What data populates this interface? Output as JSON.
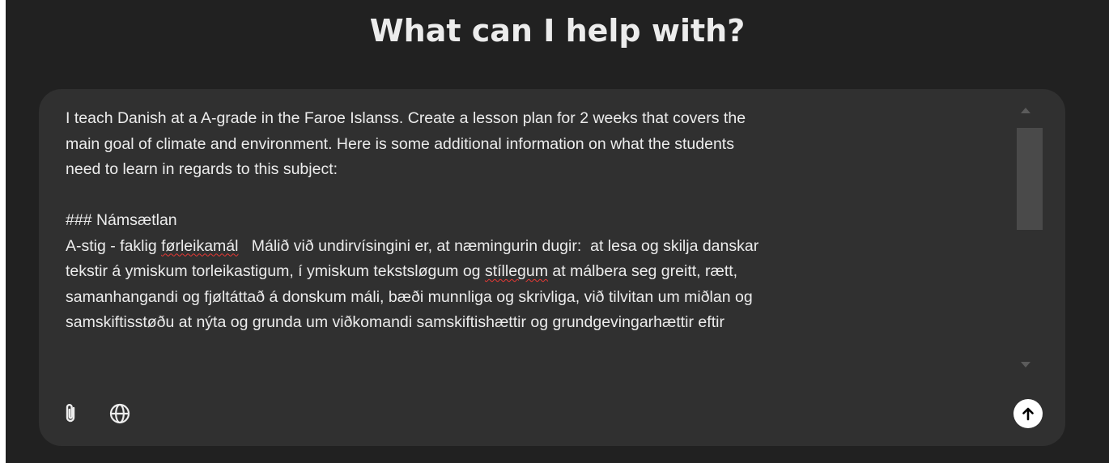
{
  "heading": "What can I help with?",
  "composer": {
    "prompt_lines": [
      "I teach Danish at a A-grade in the Faroe Islanss. Create a lesson plan for 2 weeks that covers the",
      "main goal of climate and environment. Here is some additional information on what the students",
      "need to learn in regards to this subject:",
      "",
      "### Námsætlan"
    ],
    "line6_pre": "A-stig - faklig ",
    "line6_err": "førleikamál",
    "line6_post": "   Málið við undirvísingini er, at næmingurin dugir:  at lesa og skilja danskar",
    "line7_pre": "tekstir á ymiskum torleikastigum, í ymiskum tekstsløgum og ",
    "line7_err": "stíllegum",
    "line7_post": " at málbera seg greitt, rætt,",
    "line8": "samanhangandi og fjøltáttað á donskum máli, bæði munnliga og skrivliga, við tilvitan um miðlan og",
    "line9": "samskiftisstøðu at nýta og grunda um viðkomandi samskiftishættir og grundgevingarhættir eftir"
  },
  "icons": {
    "attach": "paperclip-icon",
    "search": "globe-icon",
    "send": "arrow-up-icon"
  },
  "colors": {
    "page_background": "#212121",
    "composer_background": "#303030",
    "text": "#ececec",
    "spellcheck_underline": "#e53935",
    "send_button": "#ffffff"
  }
}
